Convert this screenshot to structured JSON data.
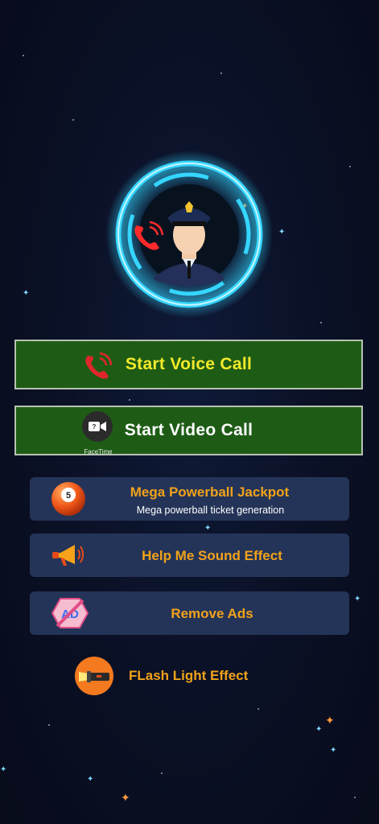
{
  "hero": {
    "icon": "police-officer-call-icon"
  },
  "voice_call": {
    "label": "Start Voice Call",
    "icon": "phone-ringing-icon",
    "color": "#f3ea2a"
  },
  "video_call": {
    "label": "Start Video Call",
    "icon": "facetime-icon",
    "icon_caption": "FaceTime"
  },
  "menu": {
    "jackpot": {
      "title": "Mega Powerball Jackpot",
      "subtitle": "Mega powerball ticket generation",
      "icon": "lottery-ball-icon",
      "ball_number": "5"
    },
    "help_me": {
      "title": "Help Me Sound Effect",
      "icon": "megaphone-icon"
    },
    "remove_ads": {
      "title": "Remove Ads",
      "icon": "no-ads-icon",
      "icon_text": "AD"
    },
    "flash": {
      "title": "FLash Light Effect",
      "icon": "flashlight-icon"
    }
  },
  "colors": {
    "background": "#0a1024",
    "green_button": "#1e5c16",
    "card": "#243458",
    "accent_orange": "#f1a21a",
    "ring": "#35d6ff"
  }
}
